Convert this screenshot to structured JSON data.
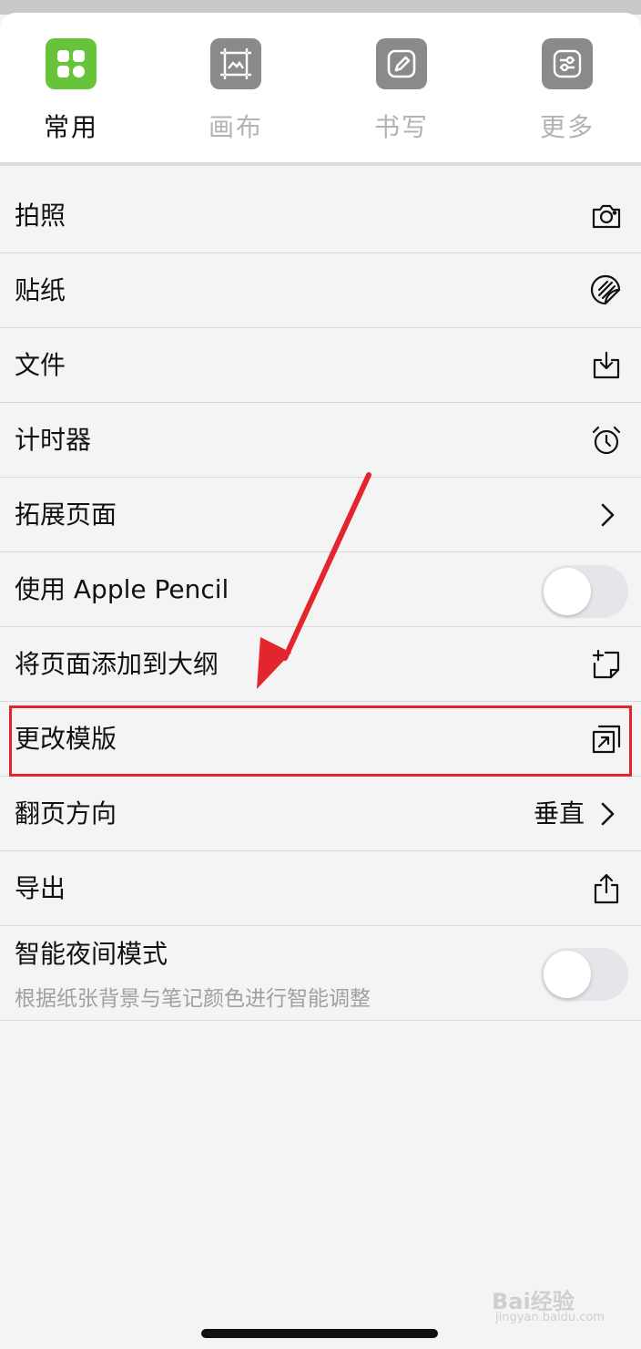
{
  "tabs": [
    {
      "label": "常用",
      "icon": "grid-icon",
      "active": true
    },
    {
      "label": "画布",
      "icon": "canvas-icon",
      "active": false
    },
    {
      "label": "书写",
      "icon": "pencil-icon",
      "active": false
    },
    {
      "label": "更多",
      "icon": "sliders-icon",
      "active": false
    }
  ],
  "menu": {
    "camera": {
      "label": "拍照",
      "icon": "camera-icon"
    },
    "sticker": {
      "label": "贴纸",
      "icon": "sticker-icon"
    },
    "file": {
      "label": "文件",
      "icon": "import-icon"
    },
    "timer": {
      "label": "计时器",
      "icon": "alarm-clock-icon"
    },
    "extend_page": {
      "label": "拓展页面",
      "icon": "chevron-right-icon"
    },
    "apple_pencil": {
      "label": "使用 Apple Pencil",
      "toggle": false
    },
    "add_outline": {
      "label": "将页面添加到大纲",
      "icon": "add-outline-icon"
    },
    "change_template": {
      "label": "更改模版",
      "icon": "change-template-icon"
    },
    "page_direction": {
      "label": "翻页方向",
      "value": "垂直",
      "icon": "chevron-right-icon"
    },
    "export": {
      "label": "导出",
      "icon": "share-icon"
    },
    "night_mode": {
      "label": "智能夜间模式",
      "sublabel": "根据纸张背景与笔记颜色进行智能调整",
      "toggle": false
    }
  },
  "watermark": {
    "line1": "Bai经验",
    "line2": "jingyan.baidu.com"
  },
  "colors": {
    "accent_green": "#67c43a",
    "highlight_red": "#e3262d",
    "icon_gray": "#8a8a8a"
  }
}
